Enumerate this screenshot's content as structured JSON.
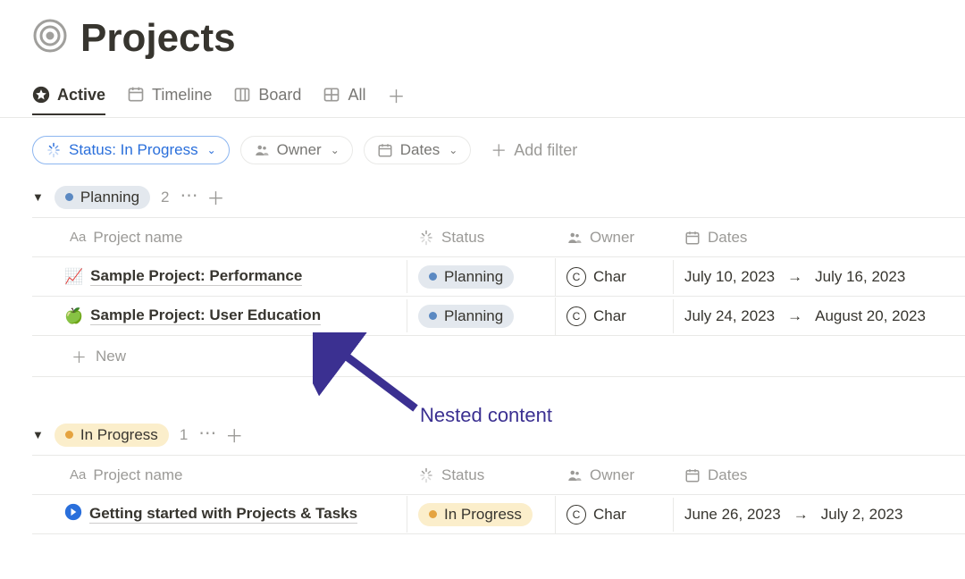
{
  "page": {
    "title": "Projects",
    "icon": "target-icon"
  },
  "tabs": [
    {
      "id": "active",
      "label": "Active",
      "icon": "star",
      "active": true
    },
    {
      "id": "timeline",
      "label": "Timeline",
      "icon": "timeline",
      "active": false
    },
    {
      "id": "board",
      "label": "Board",
      "icon": "board",
      "active": false
    },
    {
      "id": "all",
      "label": "All",
      "icon": "table",
      "active": false
    }
  ],
  "filters": {
    "status": {
      "label": "Status: In Progress",
      "style": "blue"
    },
    "owner": {
      "label": "Owner"
    },
    "dates": {
      "label": "Dates"
    },
    "add_label": "Add filter"
  },
  "columns": {
    "name": "Project name",
    "status": "Status",
    "owner": "Owner",
    "dates": "Dates"
  },
  "groups": [
    {
      "id": "planning",
      "status_label": "Planning",
      "status_style": "planning",
      "count": "2",
      "rows": [
        {
          "emoji": "📈",
          "name": "Sample Project: Performance",
          "status_label": "Planning",
          "owner_initial": "C",
          "owner_name": "Char",
          "date_start": "July 10, 2023",
          "date_end": "July 16, 2023"
        },
        {
          "emoji": "🍏",
          "name": "Sample Project: User Education",
          "status_label": "Planning",
          "owner_initial": "C",
          "owner_name": "Char",
          "date_start": "July 24, 2023",
          "date_end": "August 20, 2023"
        }
      ]
    },
    {
      "id": "in_progress",
      "status_label": "In Progress",
      "status_style": "progress",
      "count": "1",
      "rows": [
        {
          "emoji": "➡️",
          "name": "Getting started with Projects & Tasks",
          "status_label": "In Progress",
          "owner_initial": "C",
          "owner_name": "Char",
          "date_start": "June 26, 2023",
          "date_end": "July 2, 2023"
        }
      ]
    }
  ],
  "new_row_label": "New",
  "annotation": {
    "label": "Nested content"
  }
}
